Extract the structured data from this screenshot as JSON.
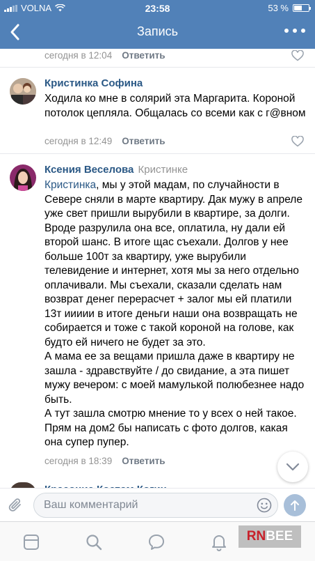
{
  "status_bar": {
    "carrier": "VOLNA",
    "time": "23:58",
    "battery": "53 %",
    "battery_level": 0.53
  },
  "nav": {
    "title": "Запись",
    "back_icon": "chevron-left-icon",
    "more_icon": "more-dots-icon"
  },
  "top_partial": {
    "time": "сегодня в 12:04",
    "reply": "Ответить"
  },
  "comments": [
    {
      "author": "Кристинка Софина",
      "text": "Ходила ко мне в солярий эта Маргарита. Короной потолок цепляла. Общалась со всеми как с г@вном",
      "time": "сегодня в 12:49",
      "reply": "Ответить"
    },
    {
      "author": "Ксения Веселова",
      "to": "Кристинке",
      "mention": "Кристинка",
      "text": ", мы у этой мадам, по случайности в Севере сняли в марте квартиру. Дак мужу в апреле уже свет пришли вырубили в квартире, за долги. Вроде разрулила она все, оплатила, ну дали ей второй шанс. В итоге щас съехали. Долгов у нее больше 100т за квартиру, уже вырубили телевидение и интернет, хотя мы за него отдельно оплачивали. Мы съехали, сказали сделать нам возврат денег перерасчет + залог мы ей платили 13т иииии в итоге деньги наши она возвращать не собирается и тоже с такой короной на голове, как будто ей ничего не будет за это.",
      "text2": "А мама ее за вещами пришла даже в квартиру не зашла - здравствуйте / до свидание, а эта пишет мужу вечером: с моей мамулькой полюбезнее надо быть.",
      "text3": "А тут зашла смотрю мнение то у всех о ней такое. Прям на дом2 бы написать с фото долгов, какая она супер пупер.",
      "time": "сегодня в 18:39",
      "reply": "Ответить"
    }
  ],
  "partial_author": "Красоние Костом Когин",
  "composer": {
    "placeholder": "Ваш комментарий"
  },
  "watermark": {
    "rn": "RN",
    "bee": "BEE"
  },
  "colors": {
    "header": "#5181b8",
    "link": "#2a5885",
    "meta": "#939393"
  }
}
